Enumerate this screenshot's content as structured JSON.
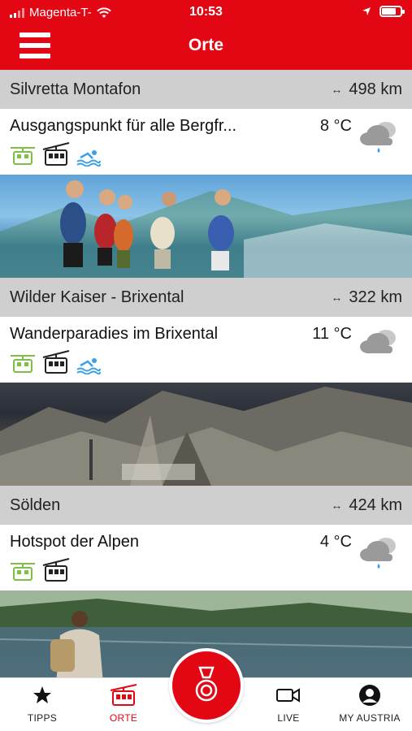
{
  "status_bar": {
    "carrier": "Magenta-T-",
    "time": "10:53"
  },
  "header": {
    "title": "Orte"
  },
  "places": [
    {
      "region": "Silvretta Montafon",
      "distance": "498 km",
      "description": "Ausgangspunkt für alle Bergfr...",
      "temperature": "8 °C",
      "weather_icon": "cloud-rain-icon",
      "amenities": [
        "gondola-icon",
        "cable-car-icon",
        "swimming-icon"
      ]
    },
    {
      "region": "Wilder Kaiser - Brixental",
      "distance": "322 km",
      "description": "Wanderparadies im Brixental",
      "temperature": "11 °C",
      "weather_icon": "cloud-icon",
      "amenities": [
        "gondola-icon",
        "cable-car-icon",
        "swimming-icon"
      ]
    },
    {
      "region": "Sölden",
      "distance": "424 km",
      "description": "Hotspot der Alpen",
      "temperature": "4 °C",
      "weather_icon": "cloud-rain-icon",
      "amenities": [
        "gondola-icon",
        "cable-car-icon"
      ]
    }
  ],
  "tabs": {
    "tipps": "TIPPS",
    "orte": "ORTE",
    "live": "LIVE",
    "my_austria": "MY AUSTRIA"
  },
  "colors": {
    "brand_red": "#e30613",
    "region_bar": "#cfcfcf",
    "amenity_green": "#7cc142",
    "amenity_blue": "#3aa0e8"
  }
}
